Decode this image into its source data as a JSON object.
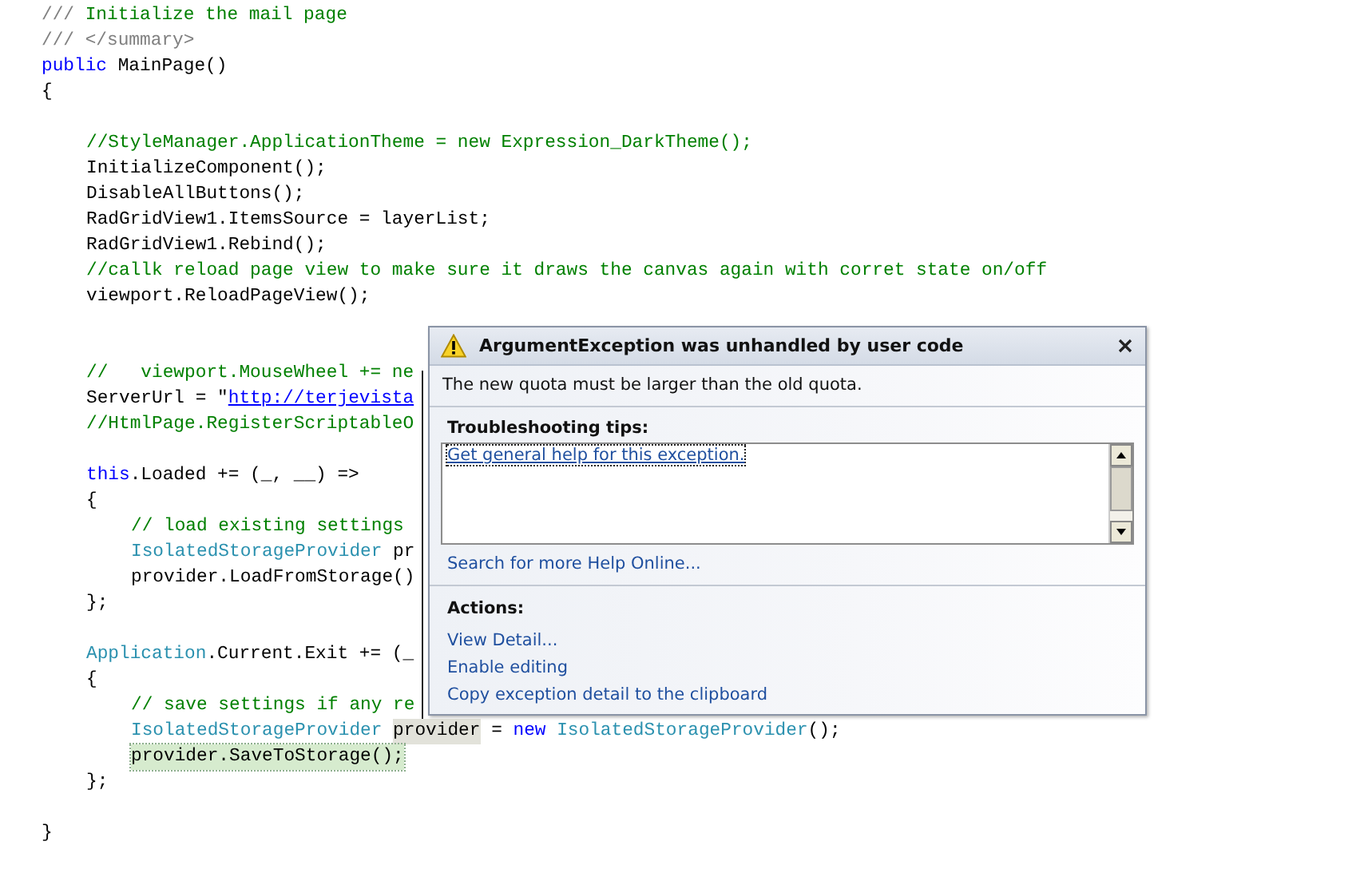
{
  "editor": {
    "lines": [
      {
        "kind": "code",
        "tokens": [
          {
            "text": "///",
            "kind": "doc"
          },
          {
            "text": " Initialize the mail page",
            "kind": "comment"
          }
        ]
      },
      {
        "kind": "code",
        "tokens": [
          {
            "text": "/// </summary>",
            "kind": "doc"
          }
        ]
      },
      {
        "kind": "code",
        "tokens": [
          {
            "text": "public",
            "kind": "keyword"
          },
          {
            "text": " MainPage()",
            "kind": "plain"
          }
        ]
      },
      {
        "kind": "code",
        "tokens": [
          {
            "text": "{",
            "kind": "plain"
          }
        ],
        "children": [
          {
            "kind": "blank"
          },
          {
            "kind": "code",
            "tokens": [
              {
                "text": "//StyleManager.ApplicationTheme = new Expression_DarkTheme();",
                "kind": "comment"
              }
            ]
          },
          {
            "kind": "code",
            "tokens": [
              {
                "text": "InitializeComponent();",
                "kind": "plain"
              }
            ]
          },
          {
            "kind": "code",
            "tokens": [
              {
                "text": "DisableAllButtons();",
                "kind": "plain"
              }
            ]
          },
          {
            "kind": "code",
            "tokens": [
              {
                "text": "RadGridView1.ItemsSource = layerList;",
                "kind": "plain"
              }
            ]
          },
          {
            "kind": "code",
            "tokens": [
              {
                "text": "RadGridView1.Rebind();",
                "kind": "plain"
              }
            ]
          },
          {
            "kind": "code",
            "tokens": [
              {
                "text": "//callk reload page view to make sure it draws the canvas again with corret state on/off",
                "kind": "comment"
              }
            ]
          },
          {
            "kind": "code",
            "tokens": [
              {
                "text": "viewport.ReloadPageView();",
                "kind": "plain"
              }
            ]
          },
          {
            "kind": "blank"
          },
          {
            "kind": "blank"
          },
          {
            "kind": "code",
            "tokens": [
              {
                "text": "//   viewport.MouseWheel += ne",
                "kind": "comment"
              }
            ]
          },
          {
            "kind": "code",
            "tokens": [
              {
                "text": "ServerUrl = \"",
                "kind": "plain"
              },
              {
                "text": "http://terjevista",
                "kind": "link"
              }
            ]
          },
          {
            "kind": "code",
            "tokens": [
              {
                "text": "//HtmlPage.RegisterScriptableO",
                "kind": "comment"
              }
            ]
          },
          {
            "kind": "blank"
          },
          {
            "kind": "code",
            "tokens": [
              {
                "text": "this",
                "kind": "keyword"
              },
              {
                "text": ".Loaded += (_, __) =>",
                "kind": "plain"
              }
            ]
          },
          {
            "kind": "code",
            "tokens": [
              {
                "text": "{",
                "kind": "plain"
              }
            ],
            "children": [
              {
                "kind": "code",
                "tokens": [
                  {
                    "text": "// load existing settings",
                    "kind": "comment"
                  }
                ]
              },
              {
                "kind": "code",
                "tokens": [
                  {
                    "text": "IsolatedStorageProvider",
                    "kind": "type"
                  },
                  {
                    "text": " pr",
                    "kind": "plain"
                  }
                ]
              },
              {
                "kind": "code",
                "tokens": [
                  {
                    "text": "provider.LoadFromStorage()",
                    "kind": "plain"
                  }
                ]
              }
            ]
          },
          {
            "kind": "code",
            "tokens": [
              {
                "text": "};",
                "kind": "plain"
              }
            ]
          },
          {
            "kind": "blank"
          },
          {
            "kind": "code",
            "tokens": [
              {
                "text": "Application",
                "kind": "type"
              },
              {
                "text": ".Current.Exit += (_",
                "kind": "plain"
              }
            ]
          },
          {
            "kind": "code",
            "tokens": [
              {
                "text": "{",
                "kind": "plain"
              }
            ],
            "children": [
              {
                "kind": "code",
                "tokens": [
                  {
                    "text": "// save settings if any re",
                    "kind": "comment"
                  }
                ]
              },
              {
                "kind": "code",
                "tokens": [
                  {
                    "text": "IsolatedStorageProvider",
                    "kind": "type"
                  },
                  {
                    "text": "provider",
                    "kind": "plain",
                    "highlighted": true
                  },
                  {
                    "text": "=",
                    "kind": "plain"
                  },
                  {
                    "text": "new",
                    "kind": "keyword"
                  },
                  {
                    "text": "IsolatedStorageProvider",
                    "kind": "type"
                  },
                  {
                    "text": "();",
                    "kind": "plain"
                  }
                ]
              },
              {
                "kind": "code",
                "tokens": [
                  {
                    "text": "provider.SaveToStorage();",
                    "kind": "plain",
                    "current_statement": true
                  }
                ]
              }
            ]
          },
          {
            "kind": "code",
            "tokens": [
              {
                "text": "};",
                "kind": "plain"
              }
            ]
          },
          {
            "kind": "blank"
          }
        ]
      },
      {
        "kind": "code",
        "tokens": [
          {
            "text": "}",
            "kind": "plain"
          }
        ]
      }
    ]
  },
  "exception_popup": {
    "title": "ArgumentException was unhandled by user code",
    "message": "The new quota must be larger than the old quota.",
    "tips_heading": "Troubleshooting tips:",
    "tips": [
      {
        "text": "Get general help for this exception.",
        "focused": true
      }
    ],
    "search_link": "Search for more Help Online...",
    "actions_heading": "Actions:",
    "actions": [
      "View Detail...",
      "Enable editing",
      "Copy exception detail to the clipboard"
    ]
  }
}
